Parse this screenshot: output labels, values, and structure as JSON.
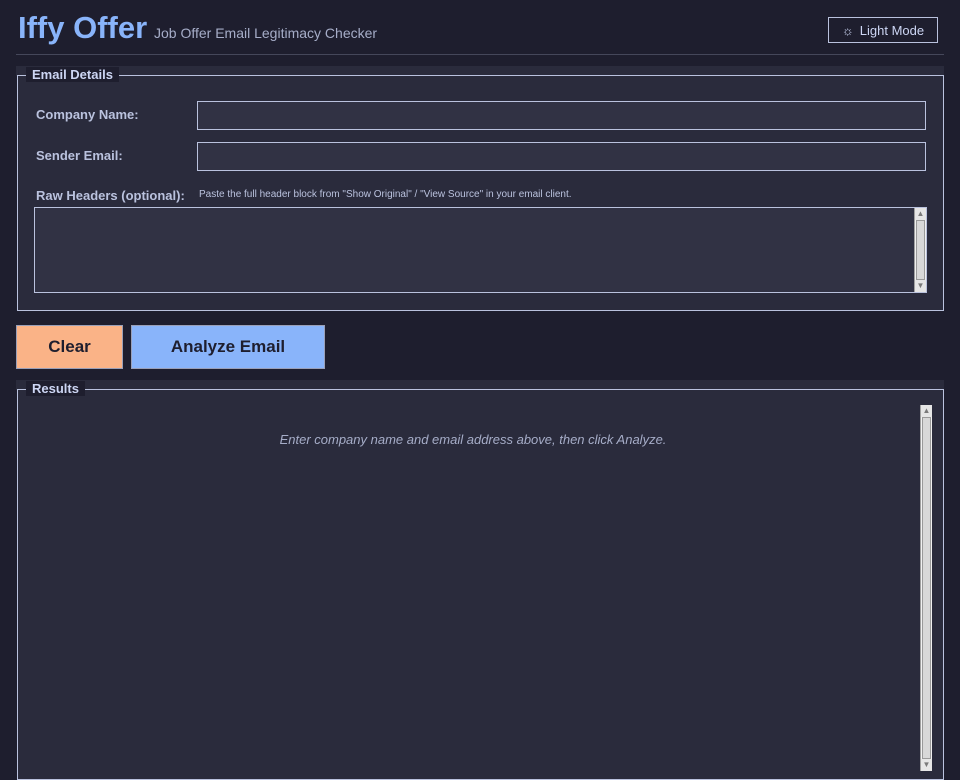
{
  "header": {
    "title": "Iffy Offer",
    "subtitle": "Job Offer Email Legitimacy Checker",
    "theme_button_label": "Light Mode",
    "theme_icon": "sun-icon"
  },
  "email_details": {
    "legend": "Email Details",
    "company_label": "Company Name:",
    "company_value": "",
    "sender_label": "Sender Email:",
    "sender_value": "",
    "headers_label": "Raw Headers (optional):",
    "headers_hint": "Paste the full header block from \"Show Original\" / \"View Source\" in your email client.",
    "headers_value": ""
  },
  "actions": {
    "clear_label": "Clear",
    "analyze_label": "Analyze Email"
  },
  "results": {
    "legend": "Results",
    "placeholder": "Enter company name and email address above, then click Analyze."
  },
  "colors": {
    "background": "#1e1e2e",
    "panel": "#2a2b3c",
    "accent": "#89b4fa",
    "clear_button": "#fab387"
  }
}
